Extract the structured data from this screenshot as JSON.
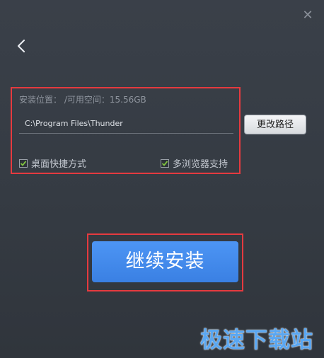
{
  "window": {
    "close_glyph": "✕"
  },
  "install_location": {
    "space_label": "安装位置：  /可用空间：15.56GB",
    "path_value": "C:\\Program Files\\Thunder",
    "change_path_label": "更改路径"
  },
  "options": {
    "desktop_shortcut": {
      "label": "桌面快捷方式",
      "checked": true
    },
    "multi_browser": {
      "label": "多浏览器支持",
      "checked": true
    }
  },
  "actions": {
    "install_label": "继续安装"
  },
  "watermark": {
    "text": "极速下载站"
  },
  "colors": {
    "accent": "#3d86e8",
    "highlight_box": "#e53a3f",
    "checkbox_tick": "#7fc23f"
  }
}
